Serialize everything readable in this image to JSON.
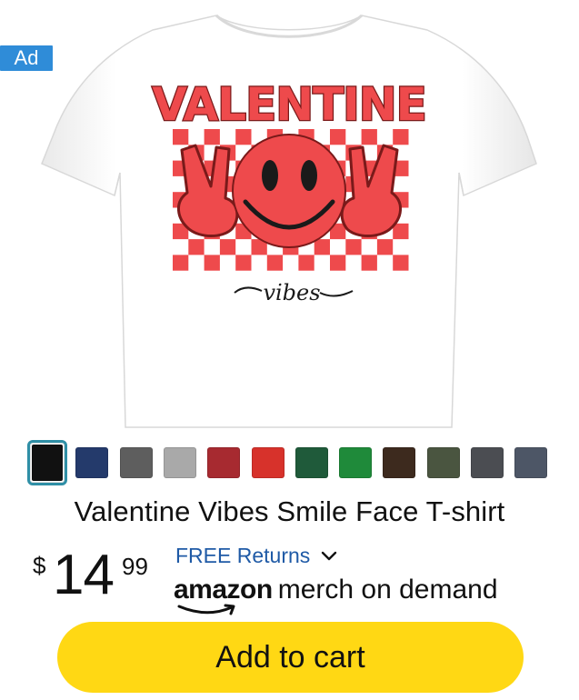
{
  "ad_badge": "Ad",
  "product": {
    "image": {
      "shirt_color": "#ffffff",
      "print_headline": "VALENTINE",
      "print_script": "vibes",
      "print_color": "#ee4a4c"
    },
    "title": "Valentine Vibes Smile Face T-shirt",
    "swatches": [
      {
        "name": "black",
        "color": "#111111",
        "selected": true
      },
      {
        "name": "navy",
        "color": "#243a6b"
      },
      {
        "name": "dark-gray",
        "color": "#5e5e5e"
      },
      {
        "name": "light-gray",
        "color": "#a9a9a9"
      },
      {
        "name": "cranberry",
        "color": "#a72a30"
      },
      {
        "name": "red",
        "color": "#d7322b"
      },
      {
        "name": "forest-green",
        "color": "#1f5a3a"
      },
      {
        "name": "kelly-green",
        "color": "#1f8a3a"
      },
      {
        "name": "brown",
        "color": "#3d2a1e"
      },
      {
        "name": "olive",
        "color": "#4a5540"
      },
      {
        "name": "charcoal",
        "color": "#4b4d52"
      },
      {
        "name": "slate",
        "color": "#4d5666"
      }
    ],
    "price": {
      "symbol": "$",
      "whole": "14",
      "fraction": "99"
    },
    "returns_label": "FREE Returns",
    "merch": {
      "brand": "amazon",
      "label": "merch on demand"
    },
    "add_to_cart_label": "Add to cart"
  },
  "colors": {
    "accent_yellow": "#ffd814",
    "link_blue": "#1f5aa6",
    "ad_blue": "#2f8cd8",
    "selected_border": "#2f8fa6"
  }
}
